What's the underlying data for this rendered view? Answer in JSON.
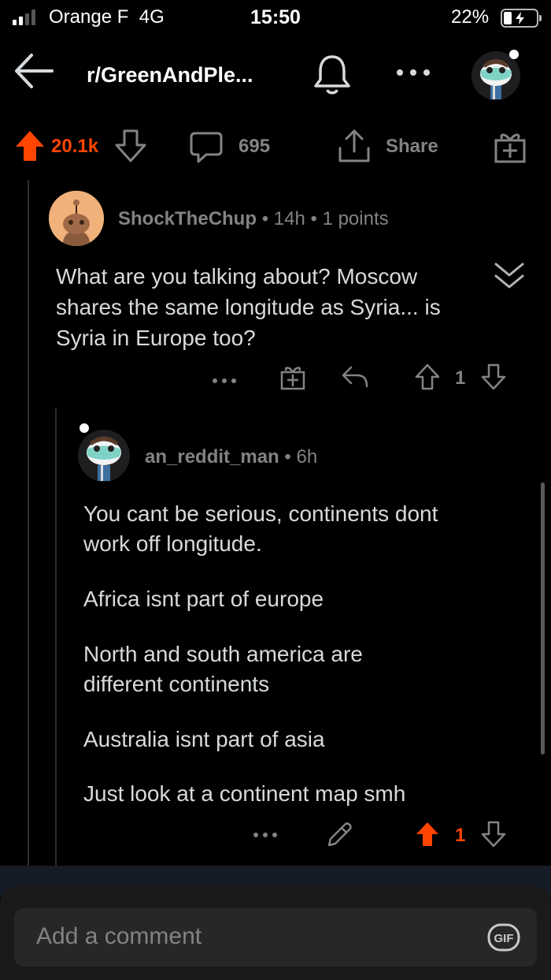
{
  "status_bar": {
    "carrier": "Orange F",
    "network": "4G",
    "time": "15:50",
    "battery": "22%"
  },
  "header": {
    "subreddit": "r/GreenAndPle..."
  },
  "post_actions": {
    "votes": "20.1k",
    "comments": "695",
    "share": "Share"
  },
  "comments": [
    {
      "user": "ShockTheChup",
      "age": "14h",
      "points": "1 points",
      "lines": [
        "What are you talking about? Moscow",
        "shares the same longitude as Syria... is",
        "Syria in Europe too?"
      ],
      "vote_count": "1"
    },
    {
      "user": "an_reddit_man",
      "age": "6h",
      "paragraphs": [
        [
          "You cant be serious, continents dont",
          "work off longitude."
        ],
        [
          "Africa isnt part of europe"
        ],
        [
          "North and south america are",
          "different continents"
        ],
        [
          "Australia isnt part of asia"
        ],
        [
          "Just look at a continent map smh"
        ]
      ],
      "vote_count": "1"
    }
  ],
  "composer": {
    "placeholder": "Add a comment",
    "gif": "GIF"
  },
  "colors": {
    "upvote": "#ff4500",
    "muted": "#818384",
    "text": "#d7dadc",
    "background": "#000000"
  },
  "icons": [
    "back-arrow-icon",
    "bell-icon",
    "more-icon",
    "upvote-icon",
    "downvote-icon",
    "comment-icon",
    "share-icon",
    "award-icon",
    "reply-icon",
    "edit-icon",
    "collapse-icon",
    "gif-icon"
  ]
}
